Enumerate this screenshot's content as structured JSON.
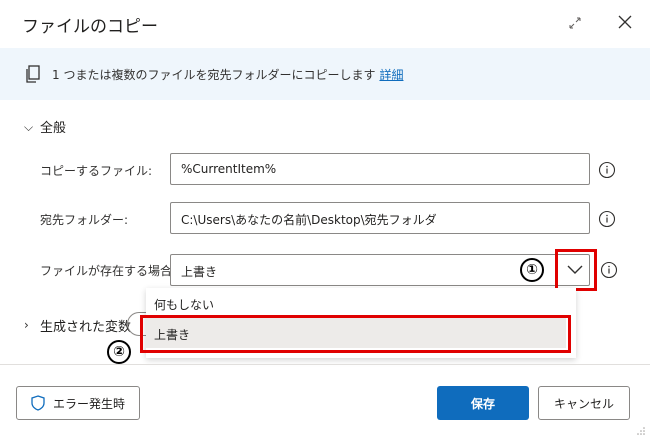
{
  "dialog": {
    "title": "ファイルのコピー"
  },
  "info": {
    "text": "1 つまたは複数のファイルを宛先フォルダーにコピーします",
    "link": "詳細"
  },
  "general": {
    "label": "全般"
  },
  "fields": {
    "source": {
      "label": "コピーするファイル:",
      "value": "%CurrentItem%"
    },
    "destination": {
      "label": "宛先フォルダー:",
      "value": "C:\\Users\\あなたの名前\\Desktop\\宛先フォルダ"
    },
    "if_exists": {
      "label": "ファイルが存在する場合:",
      "value": "上書き",
      "options": [
        "何もしない",
        "上書き"
      ]
    }
  },
  "variables": {
    "label": "生成された変数"
  },
  "annotations": {
    "badge_1": "①",
    "badge_2": "②"
  },
  "footer": {
    "error_button": "エラー発生時",
    "save_button": "保存",
    "cancel_button": "キャンセル"
  },
  "colors": {
    "primary": "#0f6cbd",
    "highlight": "#e00000",
    "info_bg": "#eff6fc"
  }
}
